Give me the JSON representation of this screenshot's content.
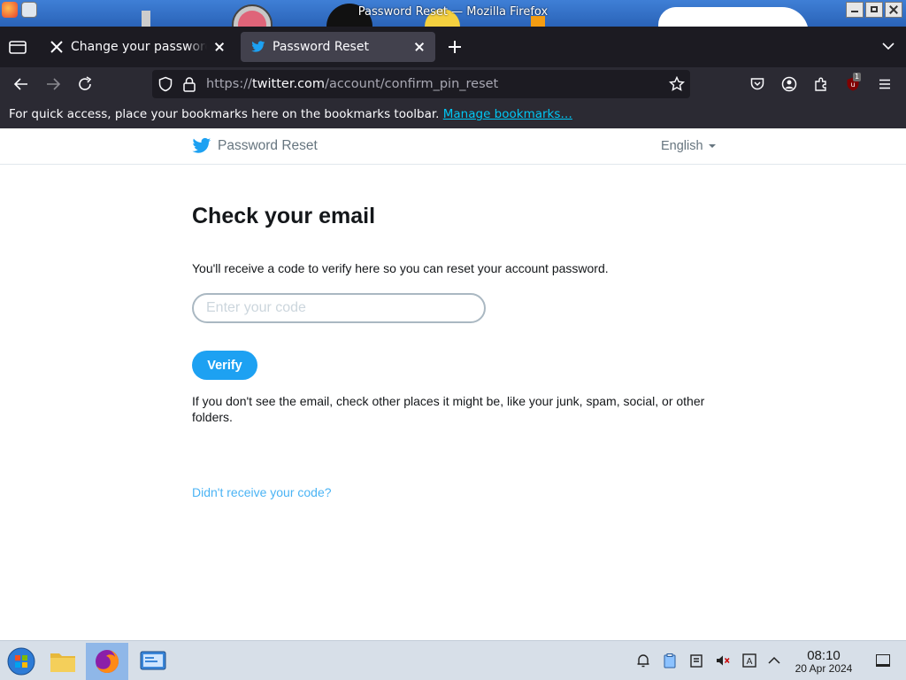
{
  "window": {
    "title": "Password Reset — Mozilla Firefox"
  },
  "tabs": [
    {
      "label": "Change your password / X",
      "icon": "x-logo-icon",
      "active": false
    },
    {
      "label": "Password Reset",
      "icon": "twitter-bird-icon",
      "active": true
    }
  ],
  "navbar": {
    "url_scheme": "https://",
    "url_domain": "twitter.com",
    "url_path": "/account/confirm_pin_reset",
    "extension_badge": "1"
  },
  "bookmarks": {
    "message": "For quick access, place your bookmarks here on the bookmarks toolbar.",
    "link": "Manage bookmarks…"
  },
  "page": {
    "header_title": "Password Reset",
    "language": "English",
    "heading": "Check your email",
    "description": "You'll receive a code to verify here so you can reset your account password.",
    "code_placeholder": "Enter your code",
    "verify_label": "Verify",
    "help_text": "If you don't see the email, check other places it might be, like your junk, spam, social, or other folders.",
    "resend_link": "Didn't receive your code?"
  },
  "taskbar": {
    "time": "08:10",
    "date": "20 Apr 2024"
  },
  "colors": {
    "twitter_blue": "#1da1f2",
    "firefox_dark": "#1c1b22",
    "firefox_toolbar": "#2b2a33",
    "link_cyan": "#00c8f5",
    "taskbar": "#d7dfe8"
  }
}
